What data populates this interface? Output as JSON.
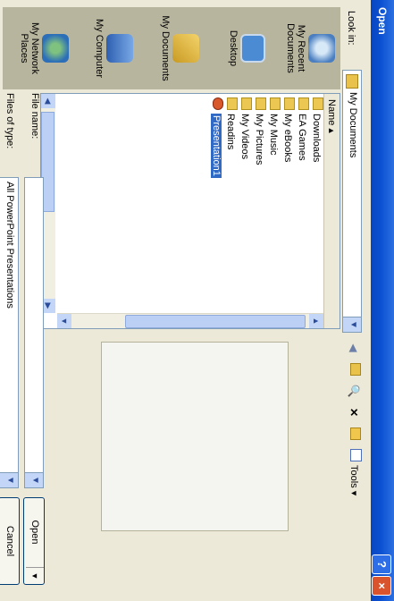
{
  "window": {
    "title": "Open",
    "help_glyph": "?",
    "close_glyph": "×"
  },
  "toolbar": {
    "look_in_label": "Look in:",
    "look_in_value": "My Documents",
    "tools_label": "Tools ▾",
    "icons": [
      "back-icon",
      "up-folder-icon",
      "search-web-icon",
      "delete-icon",
      "new-folder-icon",
      "views-icon"
    ]
  },
  "places": [
    {
      "label": "My Recent Documents",
      "icon": "recent-documents-icon"
    },
    {
      "label": "Desktop",
      "icon": "desktop-icon"
    },
    {
      "label": "My Documents",
      "icon": "my-documents-icon"
    },
    {
      "label": "My Computer",
      "icon": "my-computer-icon"
    },
    {
      "label": "My Network Places",
      "icon": "network-places-icon"
    }
  ],
  "file_list": {
    "column_header": "Name ▴",
    "items": [
      {
        "name": "Downloads",
        "type": "folder"
      },
      {
        "name": "EA Games",
        "type": "folder"
      },
      {
        "name": "My eBooks",
        "type": "folder"
      },
      {
        "name": "My Music",
        "type": "folder"
      },
      {
        "name": "My Pictures",
        "type": "folder"
      },
      {
        "name": "My Videos",
        "type": "folder"
      },
      {
        "name": "Readins",
        "type": "folder"
      },
      {
        "name": "Presentation1",
        "type": "powerpoint",
        "selected": true
      }
    ]
  },
  "footer": {
    "file_name_label": "File name:",
    "file_name_value": "",
    "files_of_type_label": "Files of type:",
    "files_of_type_value": "All PowerPoint Presentations",
    "open_label": "Open",
    "cancel_label": "Cancel"
  },
  "colors": {
    "title_bar": "#0a4fd1",
    "dialog_bg": "#ece9d8",
    "selection": "#316ac5",
    "places_bar": "#b8b59f"
  }
}
